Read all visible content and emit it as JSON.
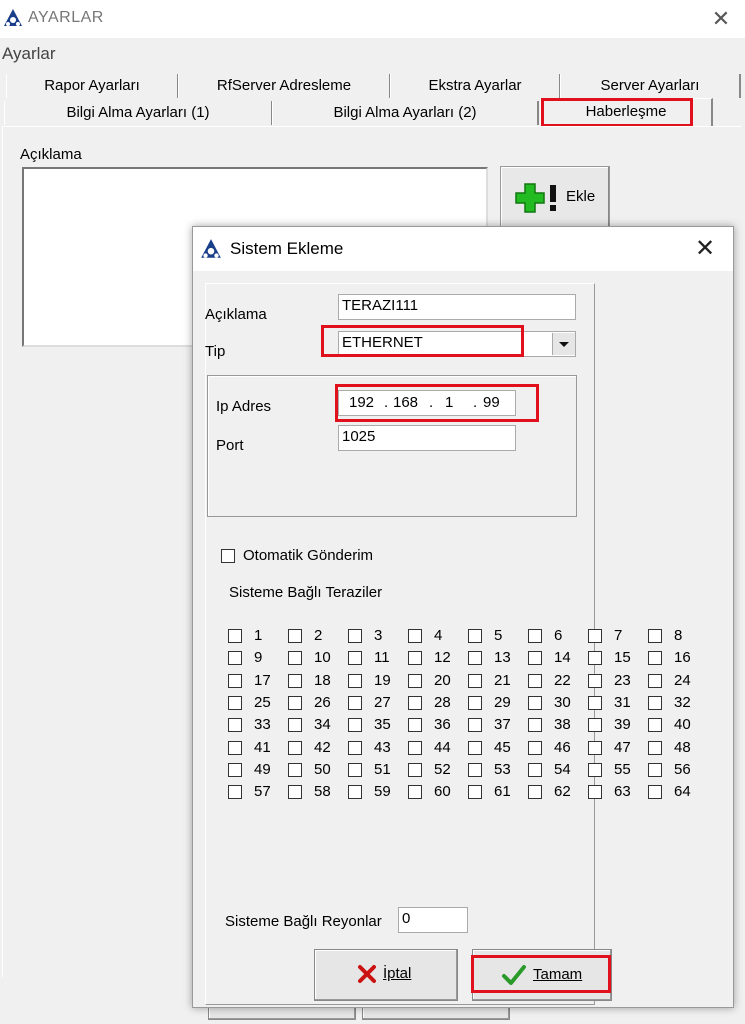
{
  "window": {
    "title": "AYARLAR",
    "menu_label": "Ayarlar",
    "close_glyph": "✕"
  },
  "tabs_row1": [
    "Rapor Ayarları",
    "RfServer Adresleme",
    "Ekstra Ayarlar",
    "Server Ayarları"
  ],
  "tabs_row2": [
    "Bilgi Alma Ayarları (1)",
    "Bilgi Alma Ayarları (2)",
    "Haberleşme"
  ],
  "main": {
    "description_label": "Açıklama",
    "add_button_label": "Ekle"
  },
  "dialog": {
    "title": "Sistem Ekleme",
    "close_glyph": "✕",
    "description_label": "Açıklama",
    "description_value": "TERAZI111",
    "type_label": "Tip",
    "type_value": "ETHERNET",
    "ip_label": "Ip Adres",
    "ip_octets": [
      "192",
      "168",
      "1",
      "99"
    ],
    "port_label": "Port",
    "port_value": "1025",
    "auto_send_label": "Otomatik Gönderim",
    "auto_send_checked": false,
    "scales_label": "Sisteme Bağlı Teraziler",
    "scales": [
      [
        "1",
        "2",
        "3",
        "4",
        "5",
        "6",
        "7",
        "8"
      ],
      [
        "9",
        "10",
        "11",
        "12",
        "13",
        "14",
        "15",
        "16"
      ],
      [
        "17",
        "18",
        "19",
        "20",
        "21",
        "22",
        "23",
        "24"
      ],
      [
        "25",
        "26",
        "27",
        "28",
        "29",
        "30",
        "31",
        "32"
      ],
      [
        "33",
        "34",
        "35",
        "36",
        "37",
        "38",
        "39",
        "40"
      ],
      [
        "41",
        "42",
        "43",
        "44",
        "45",
        "46",
        "47",
        "48"
      ],
      [
        "49",
        "50",
        "51",
        "52",
        "53",
        "54",
        "55",
        "56"
      ],
      [
        "57",
        "58",
        "59",
        "60",
        "61",
        "62",
        "63",
        "64"
      ]
    ],
    "departments_label": "Sisteme Bağlı Reyonlar",
    "departments_value": "0",
    "cancel_label": "İptal",
    "ok_label": "Tamam"
  },
  "colors": {
    "highlight": "#e0101c",
    "plus_icon": "#22bb22",
    "check_icon": "#2a9a2a",
    "cancel_icon": "#cc1111"
  }
}
